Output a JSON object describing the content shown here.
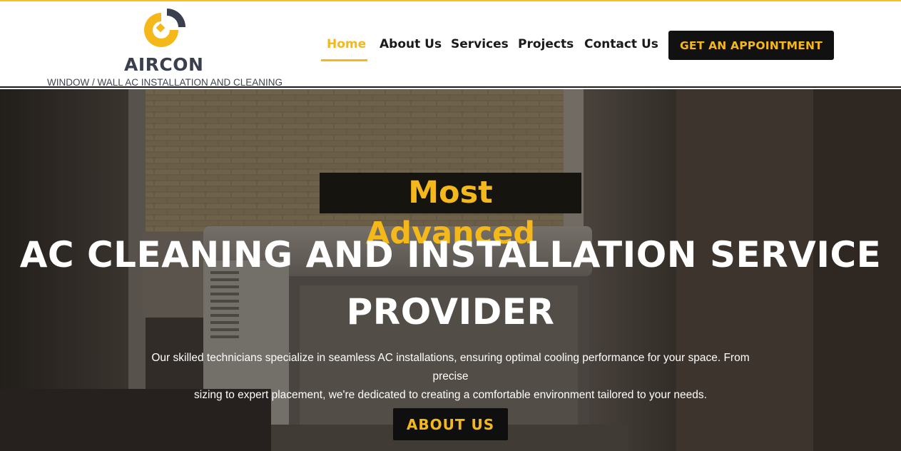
{
  "brand": {
    "name": "AIRCON",
    "tagline": "WINDOW / WALL AC INSTALLATION AND CLEANING",
    "logo_icon": "aircon-logo-icon",
    "accent_color": "#f5b81b",
    "dark_color": "#3a3f4d"
  },
  "nav": {
    "items": [
      {
        "label": "Home",
        "active": true
      },
      {
        "label": "About Us",
        "active": false
      },
      {
        "label": "Services",
        "active": false
      },
      {
        "label": "Projects",
        "active": false
      },
      {
        "label": "Contact Us",
        "active": false
      }
    ],
    "cta_label": "GET AN APPOINTMENT"
  },
  "hero": {
    "eyebrow": "Most Advanced",
    "headline_line1": "AC CLEANING AND INSTALLATION SERVICE",
    "headline_line2": "PROVIDER",
    "subtext_line1": "Our skilled technicians specialize in seamless AC installations, ensuring optimal cooling performance for your space. From precise",
    "subtext_line2": "sizing to expert placement, we're dedicated to creating a comfortable environment tailored to your needs.",
    "button_label": "ABOUT US"
  }
}
